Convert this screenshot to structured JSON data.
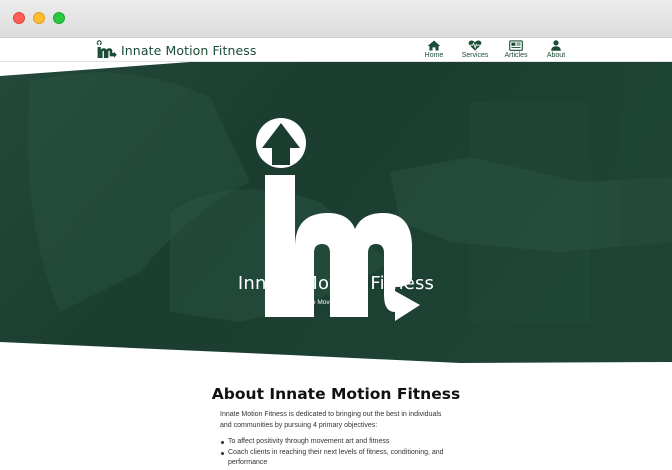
{
  "site": {
    "name": "Innate Motion Fitness",
    "tagline": "The Movement Within",
    "brand_color": "#1b4d37",
    "hero_overlay_color": "#1a3d2e"
  },
  "nav": {
    "items": [
      {
        "label": "Home",
        "icon": "home-icon"
      },
      {
        "label": "Services",
        "icon": "heart-pulse-icon"
      },
      {
        "label": "Articles",
        "icon": "newspaper-icon"
      },
      {
        "label": "About",
        "icon": "user-icon"
      }
    ]
  },
  "about": {
    "heading": "About Innate Motion Fitness",
    "intro": "Innate Motion Fitness is dedicated to bringing out the best in individuals and communities by pursuing 4 primary objectives:",
    "objectives": [
      "To affect positivity through movement art and fitness",
      "Coach clients in reaching their next levels of fitness, conditioning, and performance"
    ]
  }
}
